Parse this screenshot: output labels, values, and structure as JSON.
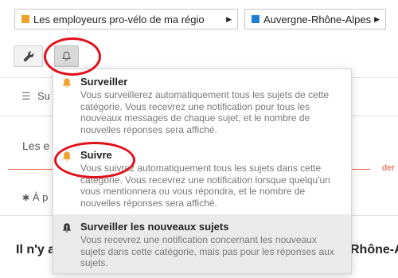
{
  "breadcrumbs": [
    {
      "label": "Les employeurs pro-vélo de ma régio",
      "color": "#f0a12c"
    },
    {
      "label": "Auvergne-Rhône-Alpes",
      "color": "#1e7ed6"
    }
  ],
  "toolbar": {
    "wrench_icon": "wrench-icon",
    "bell_icon": "bell-icon"
  },
  "background": {
    "nav_text": "Su",
    "latest_text": "Les e",
    "new_label": "der",
    "pinned_text": "À p",
    "bottom_left": "Il n'y a",
    "bottom_right": "Rhône-A"
  },
  "notification_menu": {
    "options": [
      {
        "title": "Surveiller",
        "description": "Vous surveillerez automatiquement tous les sujets de cette catégorie. Vous recevrez une notification pour tous les nouveaux messages de chaque sujet, et le nombre de nouvelles réponses sera affiché.",
        "icon": "bell-icon",
        "icon_color": "#f0a12c"
      },
      {
        "title": "Suivre",
        "description": "Vous suivrez automatiquement tous les sujets dans cette catégorie. Vous recevrez une notification lorsque quelqu'un vous mentionnera ou vous répondra, et le nombre de nouvelles réponses sera affiché.",
        "icon": "bell-icon",
        "icon_color": "#f0a12c"
      },
      {
        "title": "Surveiller les nouveaux sujets",
        "description": "Vous recevrez une notification concernant les nouveaux sujets dans cette catégorie, mais pas pour les réponses aux sujets.",
        "icon": "bell-exclamation-icon",
        "icon_color": "#333333"
      }
    ]
  }
}
